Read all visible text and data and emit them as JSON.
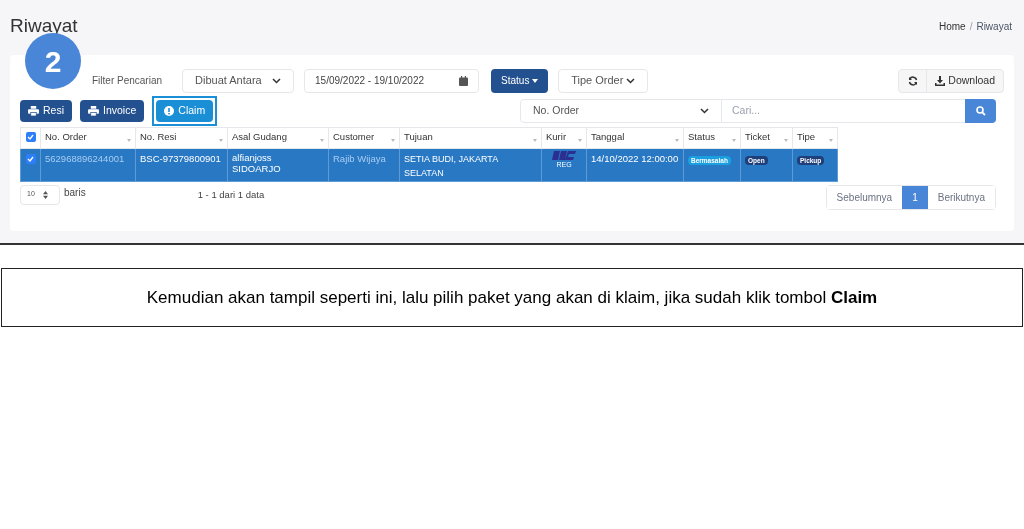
{
  "step_badge": "2",
  "page": {
    "title": "Riwayat",
    "breadcrumb": [
      "Home",
      "Riwayat"
    ],
    "breadcrumb_separator": "/"
  },
  "filters": {
    "label": "Filter Pencarian",
    "date_type": "Dibuat Antara",
    "date_range": "15/09/2022 - 19/10/2022",
    "status_button": "Status",
    "order_type": "Tipe Order",
    "download": "Download"
  },
  "actions": [
    {
      "label": "Resi",
      "kind": "print",
      "highlighted": false
    },
    {
      "label": "Invoice",
      "kind": "print",
      "highlighted": false
    },
    {
      "label": "Claim",
      "kind": "claim",
      "highlighted": true
    }
  ],
  "search": {
    "field": "No. Order",
    "placeholder": "Cari..."
  },
  "table": {
    "all_checked": true,
    "columns": [
      "No. Order",
      "No. Resi",
      "Asal Gudang",
      "Customer",
      "Tujuan",
      "Kurir",
      "Tanggal",
      "Status",
      "Ticket",
      "Tipe"
    ],
    "rows": [
      {
        "checked": true,
        "selected": true,
        "no_order": "562968896244001",
        "no_resi": "BSC-97379800901",
        "asal_gudang": "alfianjoss SIDOARJO",
        "customer": "Rajib Wijaya",
        "tujuan": "SETIA BUDI, JAKARTA SELATAN",
        "kurir_service": "REG",
        "tanggal": "14/10/2022 12:00:00",
        "status": "Bermasalah",
        "ticket": "Open",
        "tipe": "Pickup"
      }
    ]
  },
  "page_size": {
    "value": "10",
    "label": "baris"
  },
  "summary": "1 - 1 dari 1 data",
  "pagination": [
    {
      "label": "Sebelumnya",
      "selected": false
    },
    {
      "label": "1",
      "selected": true
    },
    {
      "label": "Berikutnya",
      "selected": false
    }
  ],
  "caption": "Kemudian akan tampil seperti ini, lalu pilih paket yang akan di klaim, jika sudah klik tombol **Claim**"
}
